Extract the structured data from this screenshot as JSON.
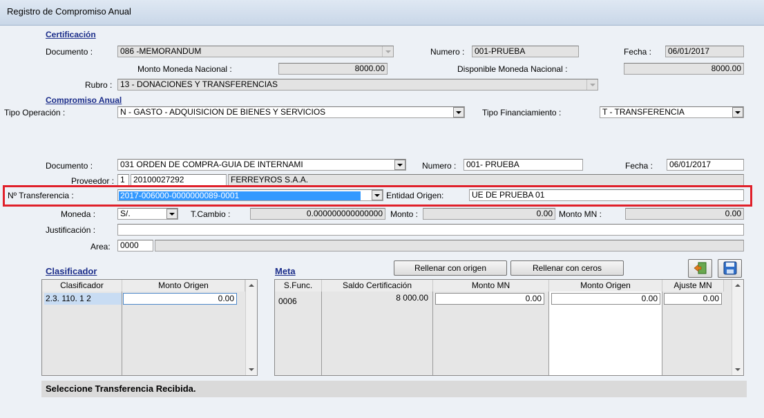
{
  "window": {
    "title": "Registro de Compromiso Anual"
  },
  "certificacion": {
    "section_label": "Certificación",
    "documento_label": "Documento :",
    "documento_value": "086 -MEMORANDUM",
    "numero_label": "Numero :",
    "numero_value": "001-PRUEBA",
    "fecha_label": "Fecha :",
    "fecha_value": "06/01/2017",
    "monto_label": "Monto Moneda Nacional :",
    "monto_value": "8000.00",
    "disponible_label": "Disponible Moneda Nacional :",
    "disponible_value": "8000.00",
    "rubro_label": "Rubro :",
    "rubro_value": "13 - DONACIONES Y TRANSFERENCIAS"
  },
  "compromiso": {
    "section_label": "Compromiso Anual",
    "tipo_operacion_label": "Tipo Operación :",
    "tipo_operacion_value": "N  - GASTO - ADQUISICION DE BIENES Y SERVICIOS",
    "tipo_financiamiento_label": "Tipo Financiamiento :",
    "tipo_financiamiento_value": "T - TRANSFERENCIA",
    "documento_label": "Documento :",
    "documento_value": "031 ORDEN DE COMPRA-GUIA DE INTERNAMI",
    "numero_label": "Numero :",
    "numero_value": "001- PRUEBA",
    "fecha_label": "Fecha :",
    "fecha_value": "06/01/2017",
    "proveedor_label": "Proveedor :",
    "proveedor_tipo": "1",
    "proveedor_ruc": "20100027292",
    "proveedor_nombre": "FERREYROS S.A.A.",
    "transferencia_label": "Nº Transferencia :",
    "transferencia_value": "2017-006000-0000000089-0001",
    "entidad_label": "Entidad Origen:",
    "entidad_value": "UE DE PRUEBA 01",
    "moneda_label": "Moneda :",
    "moneda_value": "S/.",
    "tcambio_label": "T.Cambio :",
    "tcambio_value": "0.000000000000000",
    "monto_label": "Monto :",
    "monto_value": "0.00",
    "monto_mn_label": "Monto MN :",
    "monto_mn_value": "0.00",
    "justificacion_label": "Justificación :",
    "justificacion_value": "",
    "area_label": "Area:",
    "area_value": "0000",
    "area_desc": ""
  },
  "clasificador": {
    "section_label": "Clasificador",
    "headers": [
      "Clasificador",
      "Monto Origen"
    ],
    "rows": [
      [
        "2.3. 110. 1 2",
        "0.00"
      ]
    ]
  },
  "meta": {
    "section_label": "Meta",
    "rellenar_origen_label": "Rellenar con origen",
    "rellenar_ceros_label": "Rellenar con ceros",
    "headers": [
      "S.Func.",
      "Saldo Certificación",
      "Monto MN",
      "Monto Origen",
      "Ajuste MN"
    ],
    "rows": [
      [
        "0006",
        "8 000.00",
        "0.00",
        "0.00",
        "0.00"
      ]
    ]
  },
  "status": {
    "message": "Seleccione Transferencia Recibida."
  },
  "colors": {
    "highlight_border": "#e0202a",
    "selection": "#3399ff",
    "section_text": "#1b2d8a"
  }
}
